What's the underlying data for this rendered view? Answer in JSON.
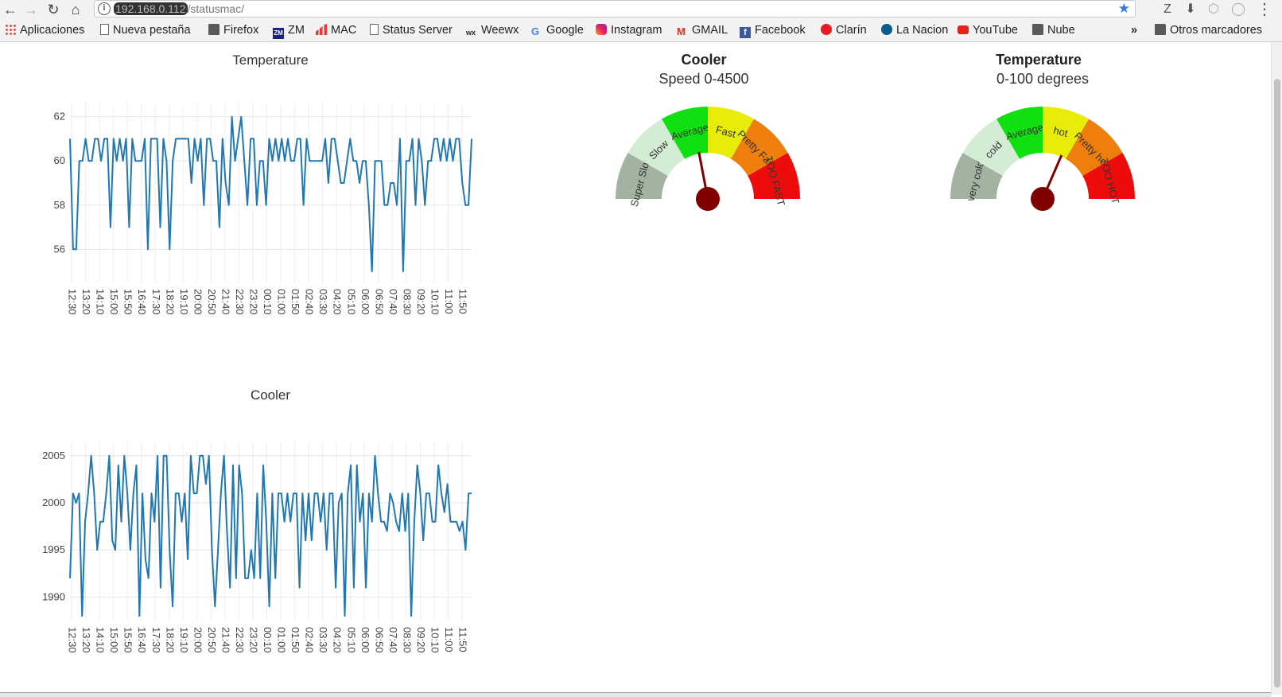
{
  "browser": {
    "url_host": "192.168.0.112",
    "url_path": "/statusmac/",
    "toolbar_right": [
      "Z",
      "⬇"
    ],
    "bookmarks": [
      {
        "label": "Aplicaciones",
        "icon": "apps-grid-icon"
      },
      {
        "label": "Nueva pestaña",
        "icon": "page-icon"
      },
      {
        "label": "Firefox",
        "icon": "folder-icon"
      },
      {
        "label": "ZM",
        "icon": "zm-icon"
      },
      {
        "label": "MAC",
        "icon": "bar-chart-icon"
      },
      {
        "label": "Status Server",
        "icon": "page-icon"
      },
      {
        "label": "Weewx",
        "icon": "weewx-icon"
      },
      {
        "label": "Google",
        "icon": "google-icon"
      },
      {
        "label": "Instagram",
        "icon": "instagram-icon"
      },
      {
        "label": "GMAIL",
        "icon": "gmail-icon"
      },
      {
        "label": "Facebook",
        "icon": "facebook-icon"
      },
      {
        "label": "Clarín",
        "icon": "clarin-icon"
      },
      {
        "label": "La Nacion",
        "icon": "la-nacion-icon"
      },
      {
        "label": "YouTube",
        "icon": "youtube-icon"
      },
      {
        "label": "Nube",
        "icon": "folder-icon"
      }
    ],
    "overflow": "»",
    "other_bookmarks": "Otros marcadores"
  },
  "chart_data": [
    {
      "type": "line",
      "title": "Temperature",
      "color": "#1f77b4",
      "ylim": [
        54.5,
        62.6
      ],
      "yticks": [
        56,
        58,
        60,
        62
      ],
      "xticks": [
        "12:30",
        "13:20",
        "14:10",
        "15:00",
        "15:50",
        "16:40",
        "17:30",
        "18:20",
        "19:10",
        "20:00",
        "20:50",
        "21:40",
        "22:30",
        "23:20",
        "00:10",
        "01:00",
        "01:50",
        "02:40",
        "03:30",
        "04:20",
        "05:10",
        "06:00",
        "06:50",
        "07:40",
        "08:30",
        "09:20",
        "10:10",
        "11:00",
        "11:50"
      ],
      "grid": true,
      "values": [
        61,
        56,
        56,
        60,
        60,
        61,
        60,
        60,
        61,
        61,
        60,
        61,
        61,
        57,
        61,
        60,
        61,
        60,
        61,
        57,
        61,
        60,
        60,
        60,
        61,
        56,
        61,
        61,
        61,
        57,
        61,
        60,
        56,
        60,
        61,
        61,
        61,
        61,
        61,
        59,
        61,
        60,
        61,
        58,
        61,
        61,
        60,
        60,
        57,
        61,
        59,
        58,
        62,
        60,
        61,
        62,
        60,
        58,
        61,
        61,
        58,
        60,
        60,
        58,
        61,
        60,
        61,
        60,
        61,
        60,
        61,
        60,
        60,
        61,
        61,
        58,
        61,
        60,
        60,
        60,
        60,
        60,
        61,
        59,
        61,
        61,
        60,
        59,
        59,
        60,
        61,
        60,
        60,
        59,
        60,
        60,
        58,
        55,
        60,
        60,
        60,
        58,
        58,
        59,
        59,
        58,
        61,
        55,
        60,
        60,
        61,
        58,
        61,
        60,
        58,
        60,
        60,
        61,
        61,
        60,
        61,
        60,
        61,
        60,
        61,
        61,
        59,
        58,
        58,
        61
      ]
    },
    {
      "type": "line",
      "title": "Cooler",
      "color": "#1f77b4",
      "ylim": [
        1987.5,
        2006.5
      ],
      "yticks": [
        1990,
        1995,
        2000,
        2005
      ],
      "xticks": [
        "12:30",
        "13:20",
        "14:10",
        "15:00",
        "15:50",
        "16:40",
        "17:30",
        "18:20",
        "19:10",
        "20:00",
        "20:50",
        "21:40",
        "22:30",
        "23:20",
        "00:10",
        "01:00",
        "01:50",
        "02:40",
        "03:30",
        "04:20",
        "05:10",
        "06:00",
        "06:50",
        "07:40",
        "08:30",
        "09:20",
        "10:10",
        "11:00",
        "11:50"
      ],
      "grid": true,
      "values": [
        1992,
        2001,
        2000,
        2001,
        1988,
        1998,
        2001,
        2005,
        2001,
        1995,
        1998,
        1998,
        2001,
        2005,
        1996,
        1995,
        2004,
        1998,
        2005,
        2001,
        1995,
        2001,
        2004,
        1988,
        2001,
        1994,
        1992,
        2001,
        1998,
        2005,
        1991,
        2005,
        2005,
        1995,
        1989,
        2001,
        2001,
        1998,
        2001,
        1994,
        2005,
        2001,
        2001,
        2005,
        2005,
        2002,
        2005,
        1995,
        1989,
        1995,
        2001,
        2005,
        1997,
        1991,
        2004,
        1992,
        2004,
        2001,
        1992,
        1992,
        1995,
        1992,
        2001,
        1992,
        2004,
        1998,
        1989,
        2001,
        1992,
        2001,
        2001,
        1998,
        2001,
        1998,
        2001,
        2001,
        1991,
        2001,
        1996,
        2001,
        1996,
        2001,
        2001,
        1998,
        2001,
        1995,
        2001,
        2001,
        1991,
        2000,
        2001,
        1988,
        2001,
        2004,
        1991,
        2004,
        1998,
        2001,
        1991,
        2001,
        1998,
        2005,
        2001,
        1998,
        1998,
        1997,
        2001,
        2000,
        1998,
        1997,
        2001,
        1997,
        2001,
        1988,
        1998,
        2004,
        2001,
        1996,
        2001,
        2001,
        1998,
        1998,
        2004,
        2001,
        1999,
        2002,
        1998,
        1998,
        1998,
        1997,
        1998,
        1995,
        2001,
        2001
      ]
    }
  ],
  "gauges": [
    {
      "title": "Cooler",
      "subtitle": "Speed 0-4500",
      "needle_fraction": 0.44,
      "needle_color": "#800000",
      "bands": [
        {
          "label": "Super Slow",
          "color": "#a3b3a1"
        },
        {
          "label": "Slow",
          "color": "#d4ebd4"
        },
        {
          "label": "Average",
          "color": "#10e010"
        },
        {
          "label": "Fast",
          "color": "#e8ec0a"
        },
        {
          "label": "Pretty Fast",
          "color": "#ef7f0c"
        },
        {
          "label": "TOO FAST",
          "color": "#ec0c0c"
        }
      ]
    },
    {
      "title": "Temperature",
      "subtitle": "0-100 degrees",
      "needle_fraction": 0.63,
      "needle_color": "#800000",
      "bands": [
        {
          "label": "very cold",
          "color": "#a3b3a1"
        },
        {
          "label": "cold",
          "color": "#d4ebd4"
        },
        {
          "label": "Average",
          "color": "#10e010"
        },
        {
          "label": "hot",
          "color": "#e8ec0a"
        },
        {
          "label": "Pretty hot",
          "color": "#ef7f0c"
        },
        {
          "label": "TOO HOT",
          "color": "#ec0c0c"
        }
      ]
    }
  ]
}
